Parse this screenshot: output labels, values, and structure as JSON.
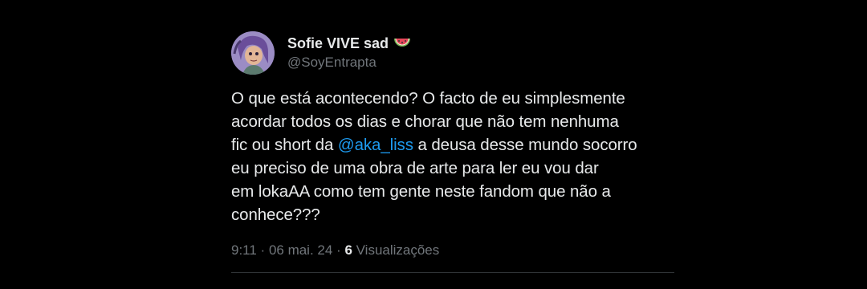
{
  "tweet": {
    "display_name": "Sofie VIVE sad",
    "name_emoji_icon": "watermelon-icon",
    "handle": "@SoyEntrapta",
    "text": {
      "line1": "O que está acontecendo? O facto de eu simplesmente",
      "line2": "acordar todos os dias e chorar que não tem nenhuma",
      "line3_before": "fic ou short da ",
      "line3_mention": "@aka_liss",
      "line3_after": " a deusa desse mundo socorro",
      "line4": "eu preciso de uma obra de arte para ler eu vou dar",
      "line5": "em lokaAA como tem gente neste fandom que não a",
      "line6": "conhece???"
    },
    "meta": {
      "time": "9:11",
      "separator1": " · ",
      "date": "06 mai. 24",
      "separator2": " · ",
      "views_count": "6",
      "views_label": " Visualizações"
    }
  },
  "colors": {
    "background": "#000000",
    "primary_text": "#e7e9ea",
    "secondary_text": "#71767b",
    "mention": "#1d9bf0",
    "divider": "#2f3336"
  }
}
